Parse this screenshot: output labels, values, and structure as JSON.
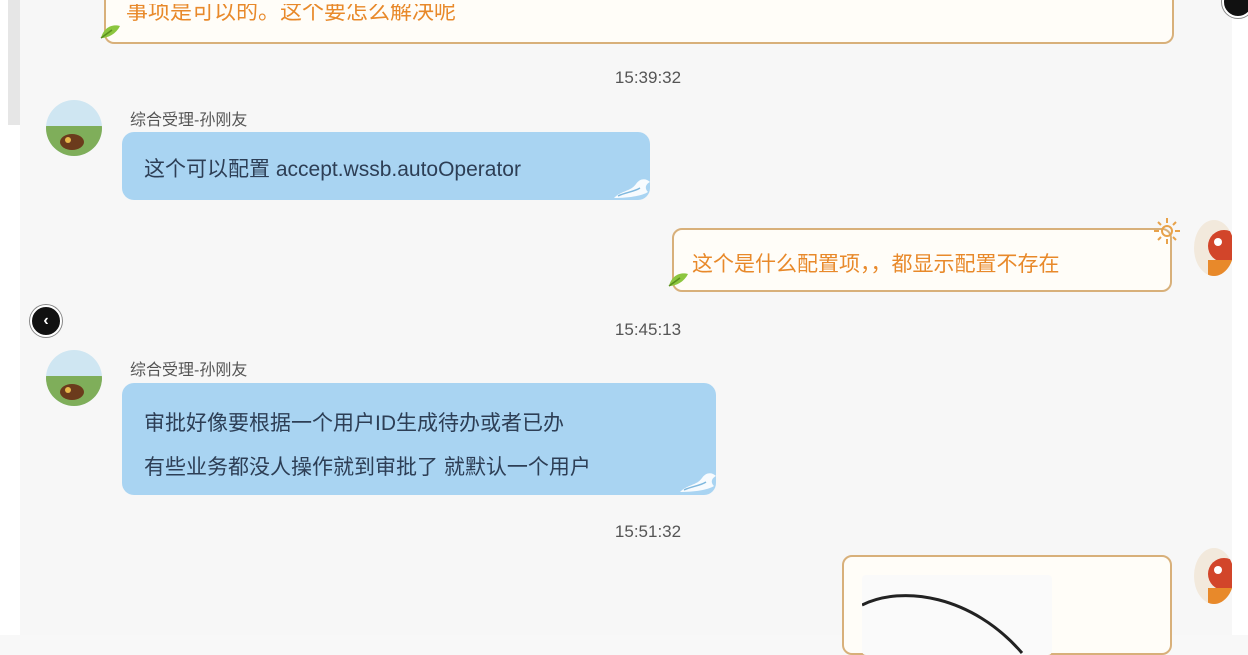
{
  "messages": {
    "top_partial": {
      "text": "事项是可以的。这个要怎么解决呢"
    },
    "time1": "15:39:32",
    "sender1": "综合受理-孙刚友",
    "msg1": "这个可以配置 accept.wssb.autoOperator",
    "reply1": "这个是什么配置项，，都显示配置不存在",
    "time2": "15:45:13",
    "sender2": "综合受理-孙刚友",
    "msg2_line1": "审批好像要根据一个用户ID生成待办或者已办",
    "msg2_line2": "有些业务都没人操作就到审批了 就默认一个用户",
    "time3": "15:51:32"
  },
  "colors": {
    "incoming_bubble": "#a9d4f2",
    "outgoing_border": "#d8b07a",
    "outgoing_text": "#e8892a"
  },
  "icons": {
    "nav_left": "chevron-left-icon"
  }
}
